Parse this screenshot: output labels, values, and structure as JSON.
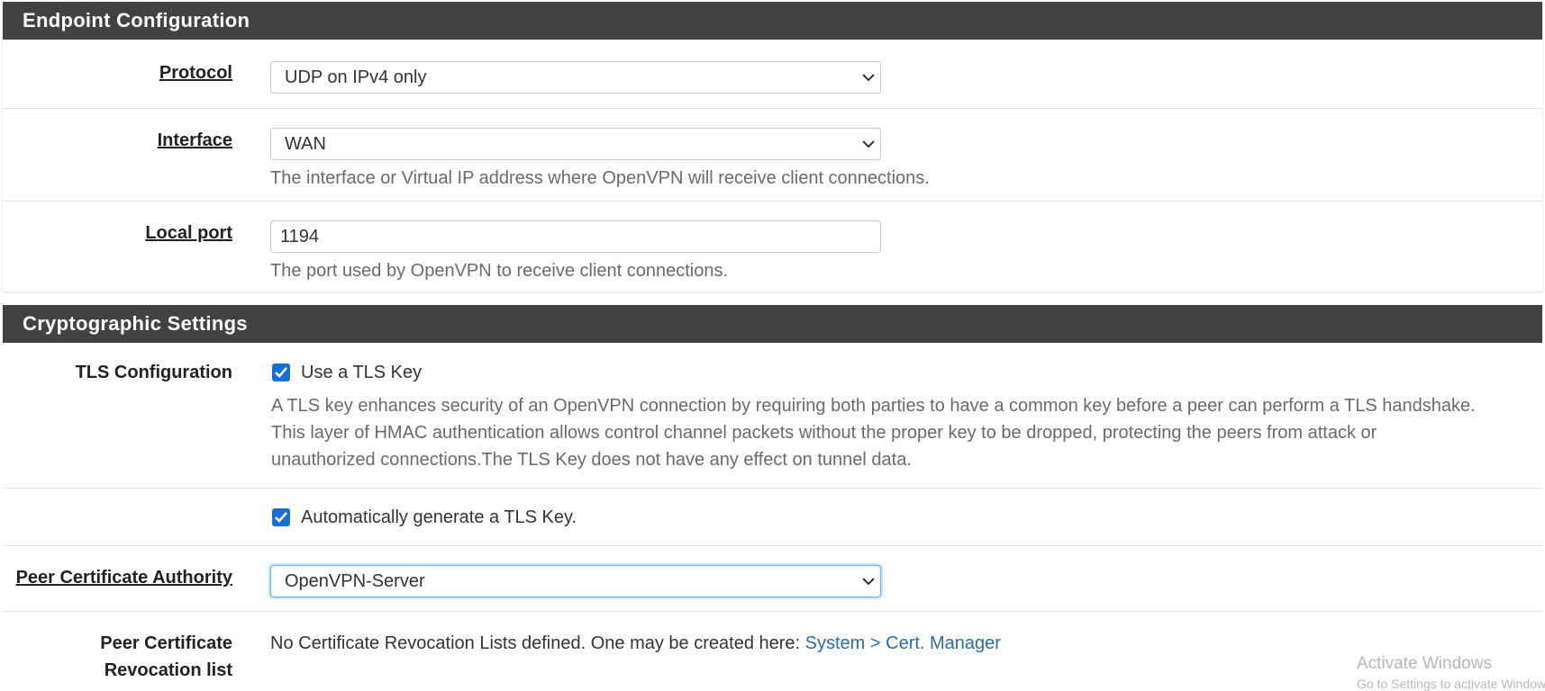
{
  "endpoint": {
    "heading": "Endpoint Configuration",
    "protocol": {
      "label": "Protocol",
      "value": "UDP on IPv4 only"
    },
    "interface": {
      "label": "Interface",
      "value": "WAN",
      "help": "The interface or Virtual IP address where OpenVPN will receive client connections."
    },
    "local_port": {
      "label": "Local port",
      "value": "1194",
      "help": "The port used by OpenVPN to receive client connections."
    }
  },
  "crypto": {
    "heading": "Cryptographic Settings",
    "tls": {
      "label": "TLS Configuration",
      "checkbox_label": "Use a TLS Key",
      "help_lines": [
        "A TLS key enhances security of an OpenVPN connection by requiring both parties to have a common key before a peer can perform a TLS handshake.",
        "This layer of HMAC authentication allows control channel packets without the proper key to be dropped, protecting the peers from attack or",
        "unauthorized connections.The TLS Key does not have any effect on tunnel data."
      ]
    },
    "auto_tls": {
      "checkbox_label": "Automatically generate a TLS Key."
    },
    "peer_ca": {
      "label": "Peer Certificate Authority",
      "value": "OpenVPN-Server"
    },
    "peer_crl": {
      "label_line1": "Peer Certificate",
      "label_line2": "Revocation list",
      "text": "No Certificate Revocation Lists defined. One may be created here: ",
      "link": "System > Cert. Manager"
    }
  },
  "watermark": {
    "line1": "Activate Windows",
    "line2": "Go to Settings to activate Windows."
  },
  "colors": {
    "heading_bg": "#424242",
    "checkbox": "#1a6fd6",
    "link": "#2c6ca8"
  }
}
